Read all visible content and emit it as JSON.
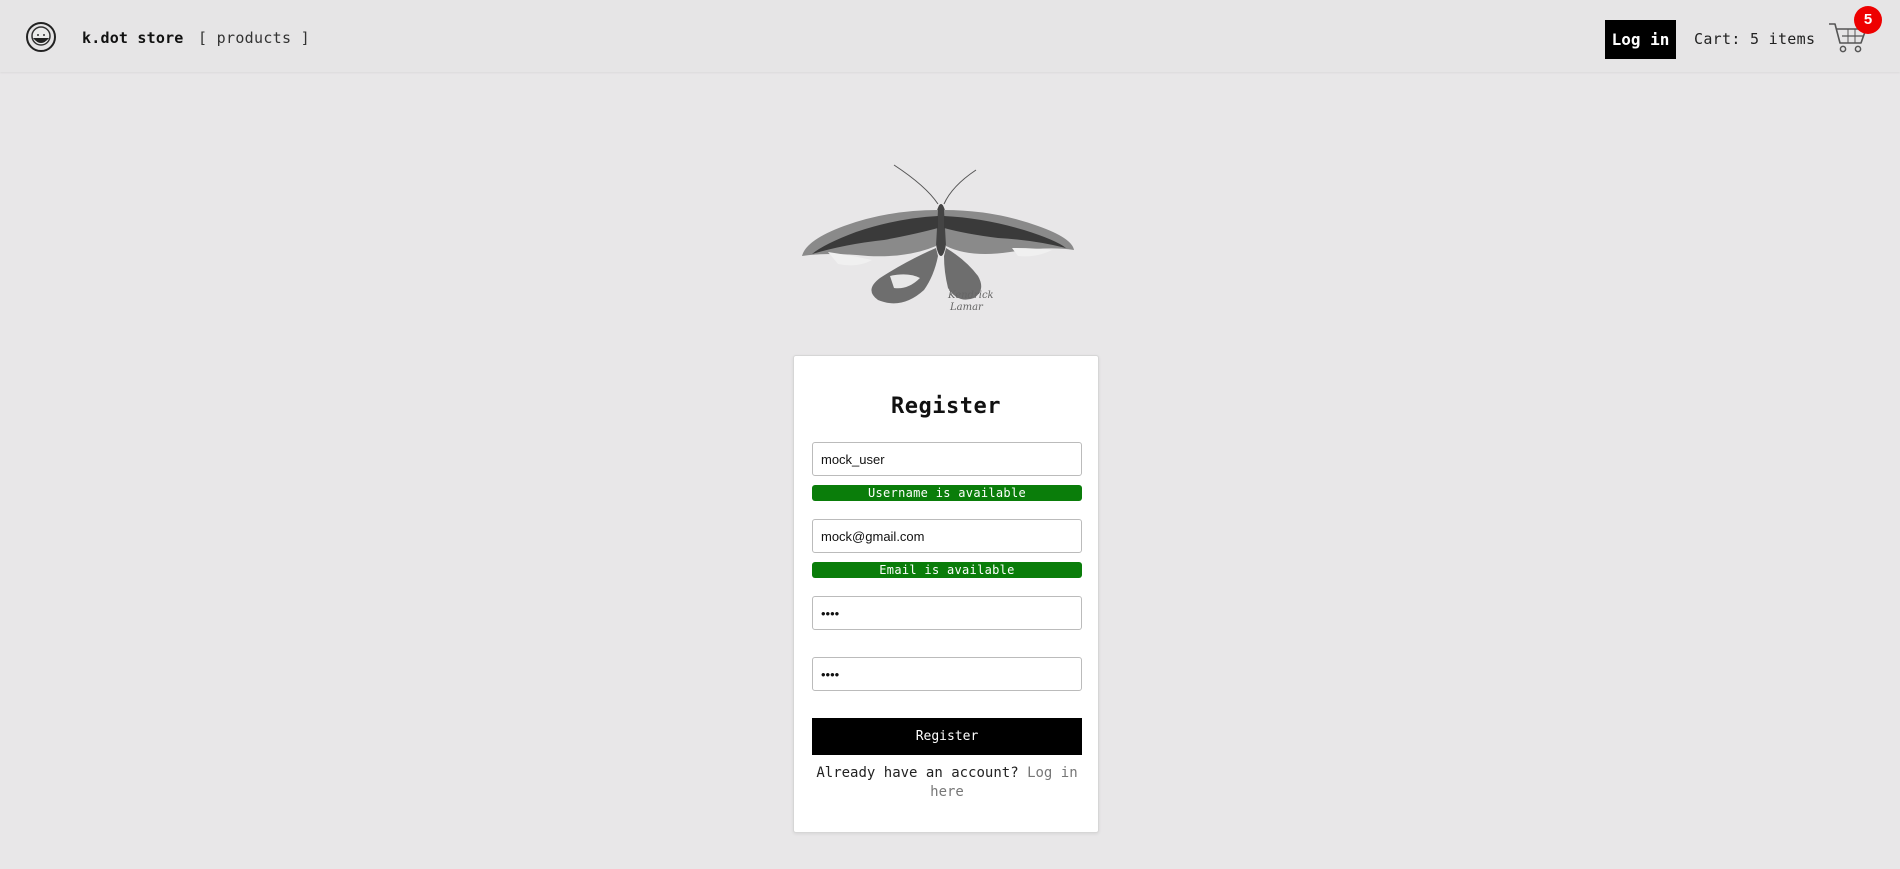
{
  "header": {
    "brand": "k.dot store",
    "products_link": "[ products ]",
    "login_label": "Log in",
    "cart_text": "Cart: 5 items",
    "cart_badge_count": "5",
    "logo_icon": "logo-face-icon",
    "cart_icon": "shopping-cart-icon"
  },
  "hero": {
    "image": "moth-illustration"
  },
  "register_form": {
    "title": "Register",
    "username_value": "mock_user",
    "username_status": "Username is available",
    "email_value": "mock@gmail.com",
    "email_status": "Email is available",
    "password_value": "••••",
    "confirm_password_value": "••••",
    "submit_label": "Register",
    "login_prompt": "Already have an account?",
    "login_link": "Log in here"
  },
  "colors": {
    "background": "#e8e7e8",
    "status_green": "#0a7d0a",
    "badge_red": "#ee0000",
    "button_black": "#000000"
  }
}
